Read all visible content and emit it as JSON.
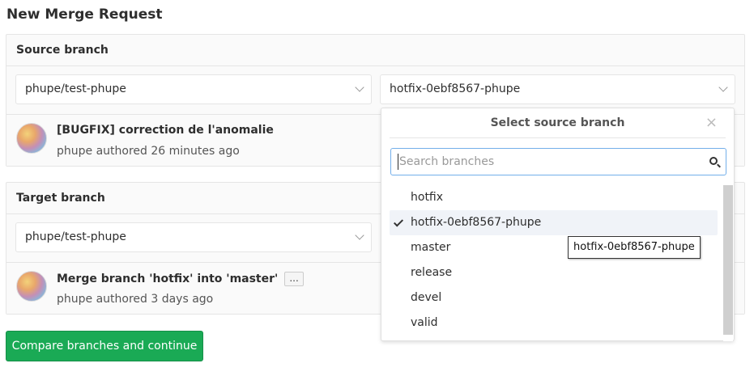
{
  "page": {
    "title": "New Merge Request"
  },
  "source": {
    "header": "Source branch",
    "project": "phupe/test-phupe",
    "branch": "hotfix-0ebf8567-phupe",
    "commit": {
      "title": "[BUGFIX] correction de l'anomalie",
      "meta": "phupe authored 26 minutes ago"
    }
  },
  "target": {
    "header": "Target branch",
    "project": "phupe/test-phupe",
    "commit": {
      "title": "Merge branch 'hotfix' into 'master'",
      "ellipsis": "...",
      "meta": "phupe authored 3 days ago"
    }
  },
  "compare_button": "Compare branches and continue",
  "dropdown": {
    "title": "Select source branch",
    "close": "×",
    "search_placeholder": "Search branches",
    "items": [
      {
        "label": "hotfix",
        "selected": false
      },
      {
        "label": "hotfix-0ebf8567-phupe",
        "selected": true
      },
      {
        "label": "master",
        "selected": false
      },
      {
        "label": "release",
        "selected": false
      },
      {
        "label": "devel",
        "selected": false
      },
      {
        "label": "valid",
        "selected": false
      }
    ]
  },
  "tooltip": "hotfix-0ebf8567-phupe",
  "colors": {
    "primary_button": "#1aaa55",
    "focus_border": "#73afea"
  }
}
